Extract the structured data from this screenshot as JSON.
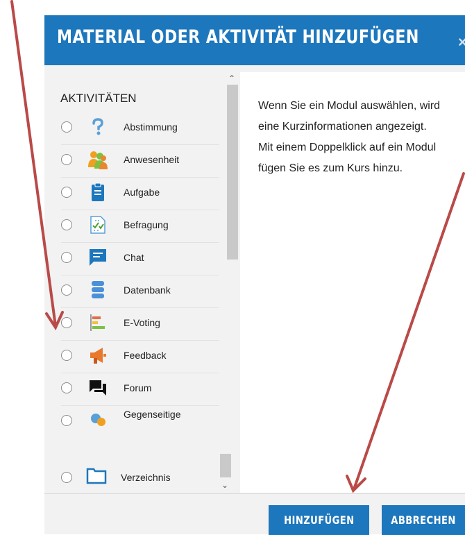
{
  "dialog": {
    "title": "MATERIAL ODER AKTIVITÄT HINZUFÜGEN",
    "close_symbol": "×"
  },
  "activities": {
    "heading": "AKTIVITÄTEN",
    "items": [
      {
        "label": "Abstimmung",
        "icon": "question-icon"
      },
      {
        "label": "Anwesenheit",
        "icon": "people-icon"
      },
      {
        "label": "Aufgabe",
        "icon": "clipboard-icon"
      },
      {
        "label": "Befragung",
        "icon": "survey-icon"
      },
      {
        "label": "Chat",
        "icon": "chat-icon"
      },
      {
        "label": "Datenbank",
        "icon": "database-icon"
      },
      {
        "label": "E-Voting",
        "icon": "bar-chart-icon"
      },
      {
        "label": "Feedback",
        "icon": "megaphone-icon"
      },
      {
        "label": "Forum",
        "icon": "forum-icon"
      },
      {
        "label": "Gegenseitige",
        "icon": "peer-review-icon"
      }
    ],
    "bottom_item": {
      "label": "Verzeichnis",
      "icon": "folder-icon"
    }
  },
  "info": {
    "lines": [
      "Wenn Sie ein Modul auswählen, wird",
      "eine Kurzinformationen angezeigt.",
      "Mit einem Doppelklick auf ein Modul",
      "fügen Sie es zum Kurs hinzu."
    ]
  },
  "footer": {
    "add_label": "HINZUFÜGEN",
    "cancel_label": "ABBRECHEN"
  },
  "colors": {
    "header_blue": "#1d77bd",
    "annotation_red": "#b94a48"
  }
}
